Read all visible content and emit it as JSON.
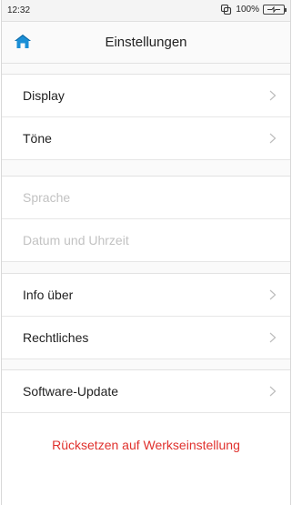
{
  "status_bar": {
    "time": "12:32",
    "battery_text": "100%",
    "sync_icon": "sync-icon",
    "battery_icon": "battery-charging-icon"
  },
  "header": {
    "title": "Einstellungen",
    "home_icon": "home-icon",
    "accent_color": "#1a8fd6"
  },
  "groups": [
    {
      "items": [
        {
          "label": "Display",
          "enabled": true
        },
        {
          "label": "Töne",
          "enabled": true
        }
      ]
    },
    {
      "items": [
        {
          "label": "Sprache",
          "enabled": false
        },
        {
          "label": "Datum und Uhrzeit",
          "enabled": false
        }
      ]
    },
    {
      "items": [
        {
          "label": "Info über",
          "enabled": true
        },
        {
          "label": "Rechtliches",
          "enabled": true
        }
      ]
    },
    {
      "items": [
        {
          "label": "Software-Update",
          "enabled": true
        }
      ]
    }
  ],
  "reset": {
    "label": "Rücksetzen auf Werkseinstellung",
    "color": "#e0312d"
  }
}
